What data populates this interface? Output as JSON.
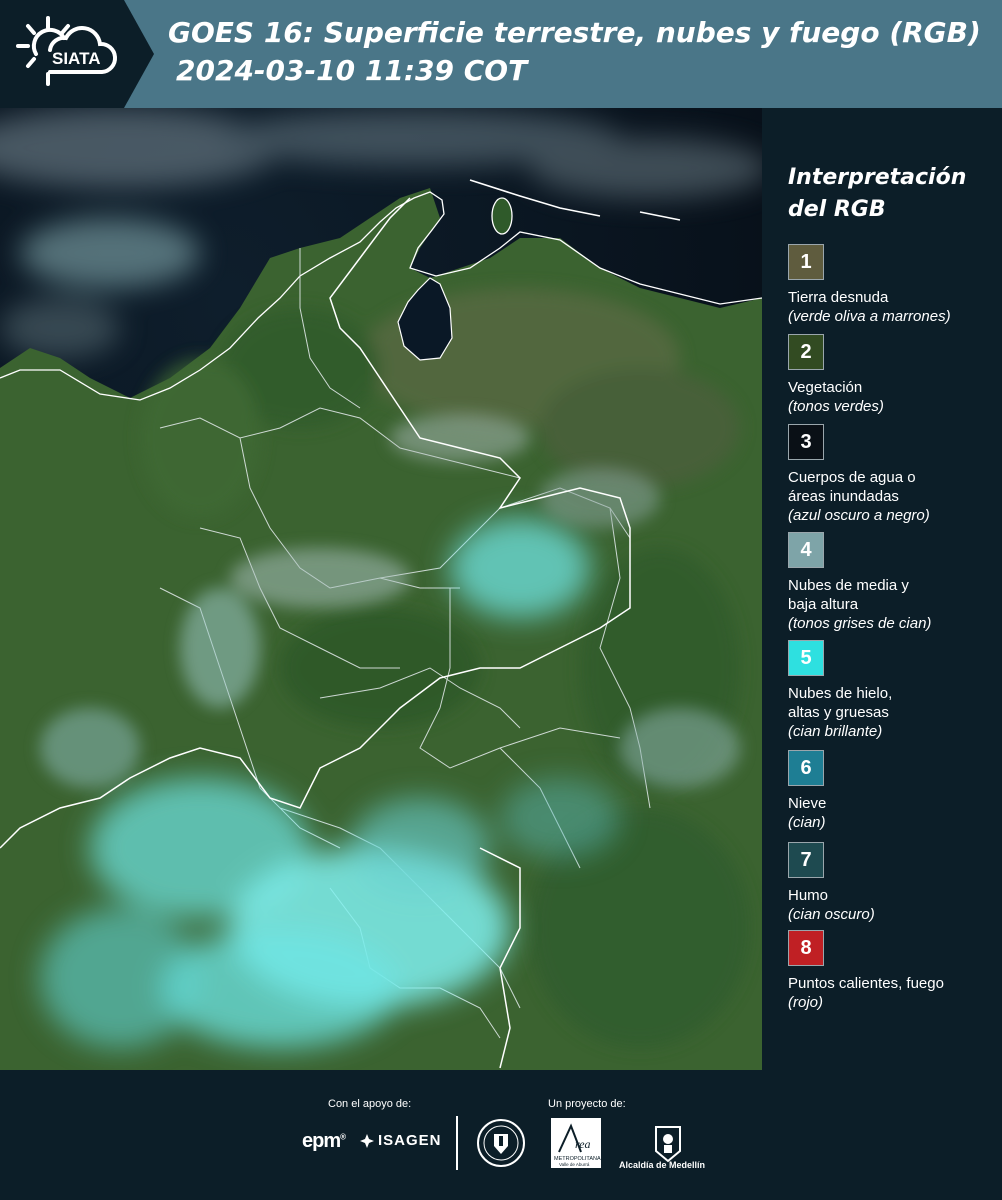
{
  "header": {
    "title_line1": "GOES 16: Superficie terrestre, nubes y fuego (RGB)",
    "title_line2": "2024-03-10 11:39 COT",
    "logo_text": "SIATA"
  },
  "legend": {
    "title": "Interpretación del RGB",
    "items": [
      {
        "num": "1",
        "label": "Tierra desnuda",
        "sub": "(verde oliva a marrones)",
        "color": "#5f5c3e"
      },
      {
        "num": "2",
        "label": "Vegetación",
        "sub": "(tonos verdes)",
        "color": "#324b22"
      },
      {
        "num": "3",
        "label": "Cuerpos de agua o\náreas inundadas",
        "sub": "(azul oscuro a negro)",
        "color": "#0a1016"
      },
      {
        "num": "4",
        "label": "Nubes de media y\nbaja altura",
        "sub": "(tonos grises de cian)",
        "color": "#7ea4a8"
      },
      {
        "num": "5",
        "label": "Nubes de hielo,\naltas y gruesas",
        "sub": "(cian brillante)",
        "color": "#2ee0e0"
      },
      {
        "num": "6",
        "label": "Nieve",
        "sub": "(cian)",
        "color": "#1e7e94"
      },
      {
        "num": "7",
        "label": "Humo",
        "sub": "(cian oscuro)",
        "color": "#1e4a50"
      },
      {
        "num": "8",
        "label": "Puntos calientes, fuego",
        "sub": "(rojo)",
        "color": "#c02024"
      }
    ]
  },
  "footer": {
    "support_label": "Con el apoyo de:",
    "project_label": "Un proyecto de:",
    "sponsors": [
      "epm",
      "ISAGEN"
    ],
    "partners": [
      "Área Metropolitana Valle de Aburrá",
      "Alcaldía de Medellín"
    ],
    "medellin_label": "Alcaldía de Medellín"
  },
  "colors": {
    "header_bg": "#4a7688",
    "panel_bg": "#0c1e28",
    "ocean": "#0a1520",
    "land": "#3a6a34",
    "cloud_cyan": "#7ff0ee"
  }
}
